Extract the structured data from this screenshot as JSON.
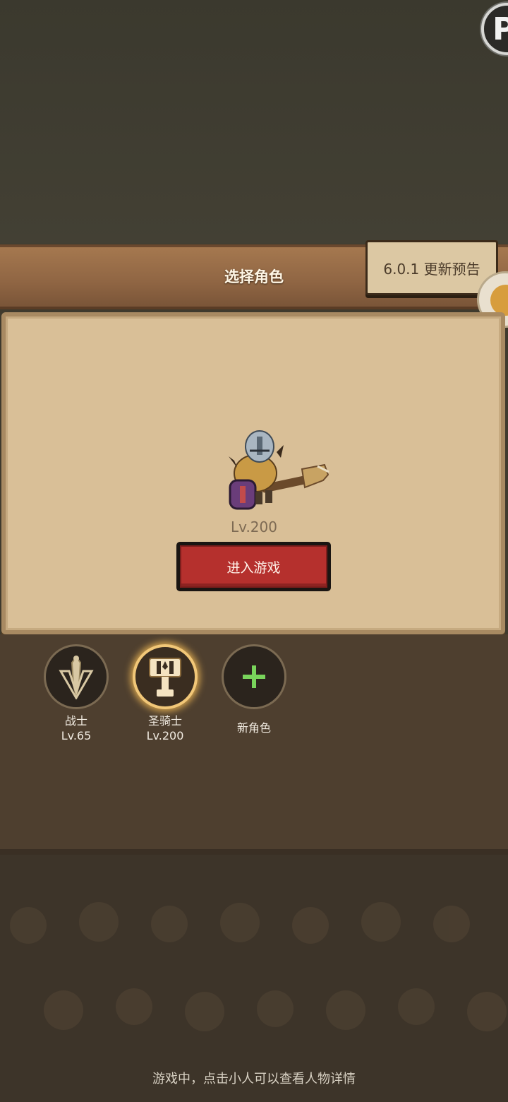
{
  "corner_badge": {
    "label": "P"
  },
  "header": {
    "title": "选择角色",
    "update_notice": "6.0.1 更新预告"
  },
  "selected_hero": {
    "level": "Lv.200",
    "enter_button": "进入游戏"
  },
  "roles": [
    {
      "name": "战士",
      "level": "Lv.65",
      "icon": "sword-shield-icon",
      "selected": false
    },
    {
      "name": "圣骑士",
      "level": "Lv.200",
      "icon": "hammer-icon",
      "selected": true
    },
    {
      "name": "新角色",
      "level": "",
      "icon": "plus-icon",
      "selected": false
    }
  ],
  "colors": {
    "accent_red": "#b5302d",
    "selected_glow": "#f1c778",
    "plus_green": "#79d45b"
  },
  "footer": {
    "hint": "游戏中，点击小人可以查看人物详情"
  }
}
